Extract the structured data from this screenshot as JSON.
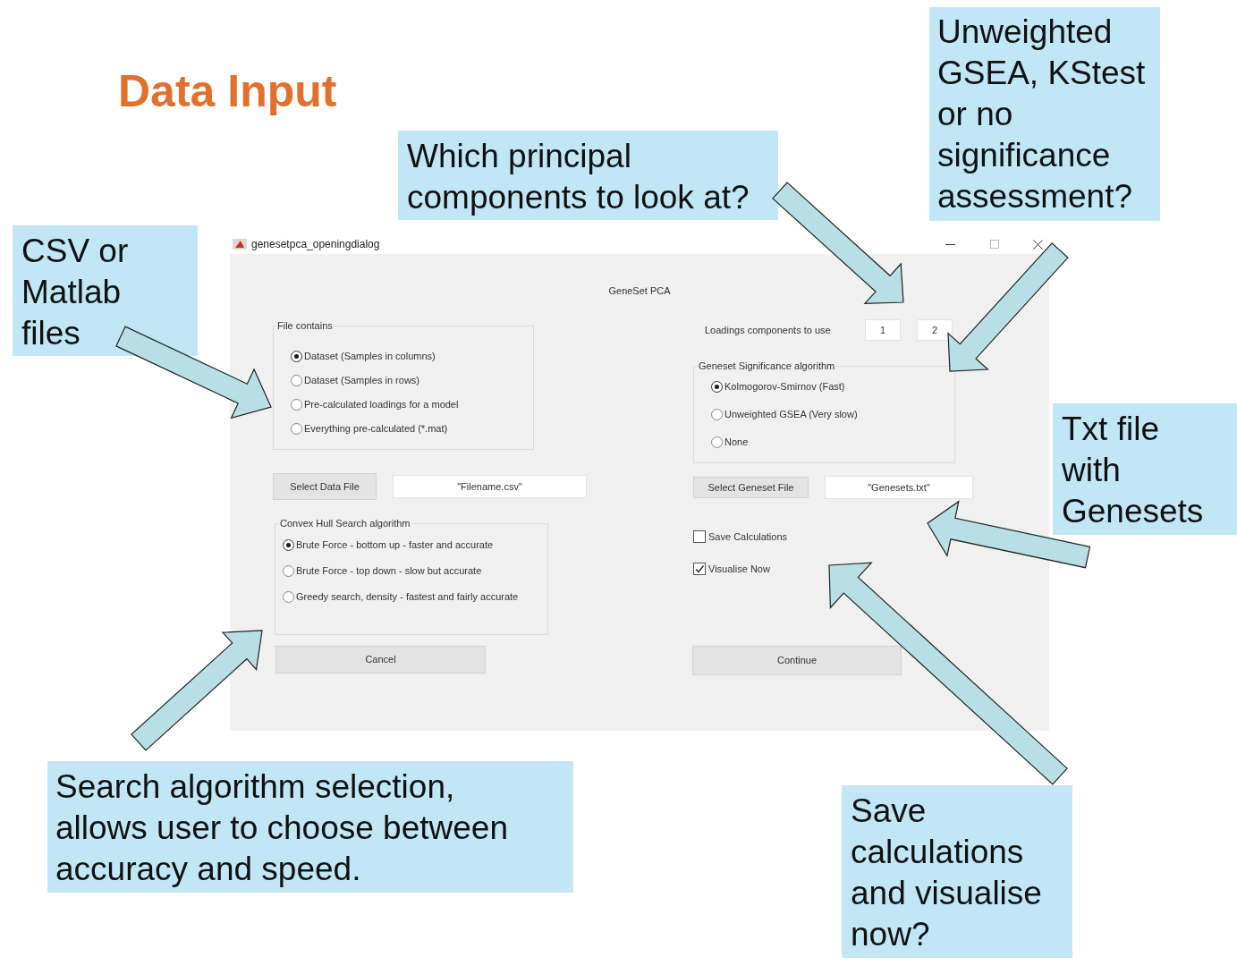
{
  "slide_title": "Data Input",
  "callouts": [
    "Which principal components to look at?",
    "Unweighted GSEA, KStest or no significance assessment?",
    "CSV or Matlab files",
    "Txt file with Genesets",
    "Search algorithm selection, allows user to choose between accuracy and speed.",
    "Save calculations and visualise now?"
  ],
  "window": {
    "title": "genesetpca_openingdialog",
    "heading": "GeneSet PCA"
  },
  "file_contains": {
    "label": "File contains",
    "options": [
      {
        "label": "Dataset (Samples in columns)",
        "selected": true
      },
      {
        "label": "Dataset (Samples in rows)",
        "selected": false
      },
      {
        "label": "Pre-calculated loadings for a model",
        "selected": false
      },
      {
        "label": "Everything pre-calculated (*.mat)",
        "selected": false
      }
    ]
  },
  "data_file": {
    "button": "Select Data File",
    "value": "\"Filename.csv\""
  },
  "convex_hull": {
    "label": "Convex Hull Search algorithm",
    "options": [
      {
        "label": "Brute Force - bottom up - faster and accurate",
        "selected": true
      },
      {
        "label": "Brute Force - top down - slow but accurate",
        "selected": false
      },
      {
        "label": "Greedy search, density - fastest and fairly accurate",
        "selected": false
      }
    ]
  },
  "cancel_button": "Cancel",
  "loadings": {
    "label": "Loadings components to use",
    "values": [
      "1",
      "2"
    ]
  },
  "significance": {
    "label": "Geneset Significance algorithm",
    "options": [
      {
        "label": "Kolmogorov-Smirnov (Fast)",
        "selected": true
      },
      {
        "label": "Unweighted GSEA (Very slow)",
        "selected": false
      },
      {
        "label": "None",
        "selected": false
      }
    ]
  },
  "geneset_file": {
    "button": "Select Geneset File",
    "value": "\"Genesets.txt\""
  },
  "checkboxes": [
    {
      "label": "Save Calculations",
      "checked": false
    },
    {
      "label": "Visualise Now",
      "checked": true
    }
  ],
  "continue_button": "Continue"
}
